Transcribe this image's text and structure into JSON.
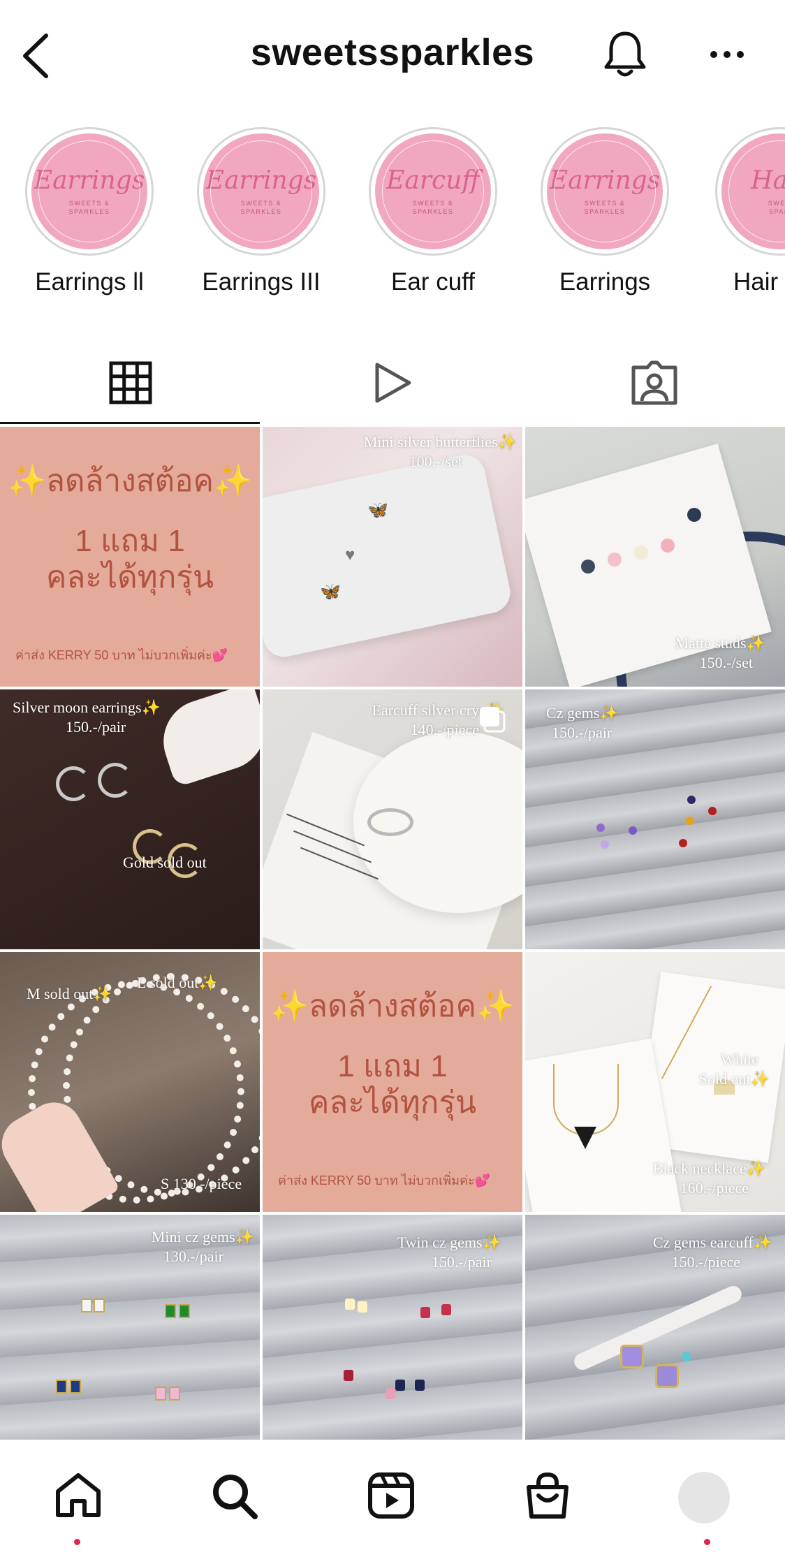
{
  "header": {
    "username": "sweetssparkles",
    "back_icon": "chevron-left-icon",
    "bell_icon": "bell-icon",
    "more_icon": "more-horizontal-icon"
  },
  "highlights": [
    {
      "label": "Earrings ll",
      "cover_text": "Earrings",
      "cover_sub1": "SWEETS &",
      "cover_sub2": "SPARKLES"
    },
    {
      "label": "Earrings III",
      "cover_text": "Earrings",
      "cover_sub1": "SWEETS &",
      "cover_sub2": "SPARKLES"
    },
    {
      "label": "Ear cuff",
      "cover_text": "Earcuff",
      "cover_sub1": "SWEETS &",
      "cover_sub2": "SPARKLES"
    },
    {
      "label": "Earrings",
      "cover_text": "Earrings",
      "cover_sub1": "SWEETS &",
      "cover_sub2": "SPARKLES"
    },
    {
      "label": "Hair",
      "cover_text": "Hair",
      "cover_sub1": "SWEE",
      "cover_sub2": "SPAR"
    }
  ],
  "tabs": [
    {
      "icon": "grid-icon",
      "active": true
    },
    {
      "icon": "reels-play-icon",
      "active": false
    },
    {
      "icon": "tagged-person-icon",
      "active": false
    }
  ],
  "posts": [
    {
      "type": "promo",
      "title": "✨ลดล้างสต้อค✨",
      "line1": "1 แถม 1",
      "line2": "คละได้ทุกรุ่น",
      "footer": "ค่าส่ง KERRY 50 บาท ไม่บวกเพิ่มค่ะ💕"
    },
    {
      "type": "photo",
      "caption1": "Mini silver butterflies✨",
      "caption2": "100.-/set"
    },
    {
      "type": "photo",
      "caption1": "Matte studs✨",
      "caption2": "150.-/set"
    },
    {
      "type": "photo",
      "caption1": "Silver moon earrings✨",
      "caption2": "150.-/pair",
      "caption3": "Gold sold out"
    },
    {
      "type": "photo",
      "caption1": "Earcuff silver crys✨",
      "caption2": "140.-/piece",
      "multi_icon": "carousel-icon"
    },
    {
      "type": "photo",
      "caption1": "Cz gems✨",
      "caption2": "150.-/pair"
    },
    {
      "type": "photo",
      "caption1": "M sold out✨",
      "caption2": "L sold out✨",
      "caption3": "S 130.-/piece"
    },
    {
      "type": "promo",
      "title": "✨ลดล้างสต้อค✨",
      "line1": "1 แถม 1",
      "line2": "คละได้ทุกรุ่น",
      "footer": "ค่าส่ง KERRY 50 บาท ไม่บวกเพิ่มค่ะ💕"
    },
    {
      "type": "photo",
      "caption1": "White",
      "caption2": "Sold out✨",
      "caption3": "Black necklace✨",
      "caption4": "160.-/piece"
    },
    {
      "type": "photo",
      "caption1": "Mini cz gems✨",
      "caption2": "130.-/pair"
    },
    {
      "type": "photo",
      "caption1": "Twin cz gems✨",
      "caption2": "150.-/pair"
    },
    {
      "type": "photo",
      "caption1": "Cz gems earcuff✨",
      "caption2": "150.-/piece"
    }
  ],
  "bottom_nav": [
    {
      "icon": "home-icon",
      "has_dot": true
    },
    {
      "icon": "search-icon",
      "has_dot": false
    },
    {
      "icon": "reels-icon",
      "has_dot": false
    },
    {
      "icon": "shop-bag-icon",
      "has_dot": false
    },
    {
      "icon": "profile-avatar",
      "has_dot": true
    }
  ],
  "colors": {
    "promo_bg": "#e4ab9a",
    "promo_text": "#b2533f",
    "highlight_pink": "#f2a7c0",
    "notification_dot": "#e0264f"
  }
}
